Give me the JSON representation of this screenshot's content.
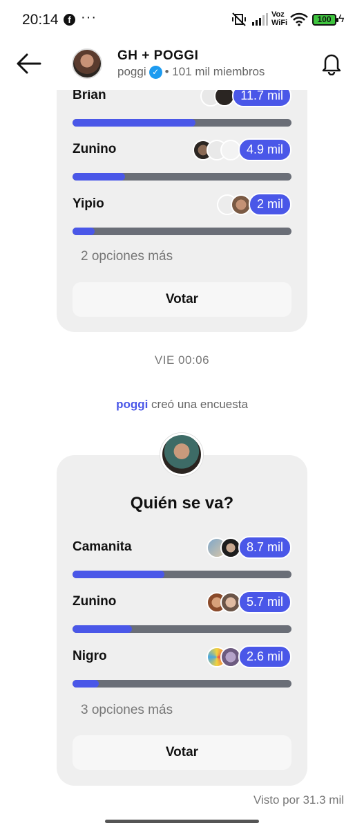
{
  "status_bar": {
    "time": "20:14",
    "app_icon": "facebook-icon",
    "more": "···",
    "network_label": "Voz\nWiFi",
    "battery": "100"
  },
  "header": {
    "title": "GH + POGGI",
    "owner": "poggi",
    "members": "• 101 mil miembros"
  },
  "poll1": {
    "options": [
      {
        "label": "Brian",
        "count": "11.7 mil",
        "fraction": 0.56
      },
      {
        "label": "Zunino",
        "count": "4.9 mil",
        "fraction": 0.24
      },
      {
        "label": "Yipio",
        "count": "2 mil",
        "fraction": 0.1
      }
    ],
    "more_options": "2 opciones más",
    "vote_label": "Votar"
  },
  "timestamp": "VIE 00:06",
  "created": {
    "author": "poggi",
    "text": " creó una encuesta"
  },
  "poll2": {
    "question": "Quién se va?",
    "options": [
      {
        "label": "Camanita",
        "count": "8.7 mil",
        "fraction": 0.42
      },
      {
        "label": "Zunino",
        "count": "5.7 mil",
        "fraction": 0.27
      },
      {
        "label": "Nigro",
        "count": "2.6 mil",
        "fraction": 0.12
      }
    ],
    "more_options": "3 opciones más",
    "vote_label": "Votar"
  },
  "seen_by": "Visto por 31.3 mil",
  "colors": {
    "accent": "#4a57e8",
    "bar_track": "#6a6e77",
    "card_bg": "#efefef"
  }
}
